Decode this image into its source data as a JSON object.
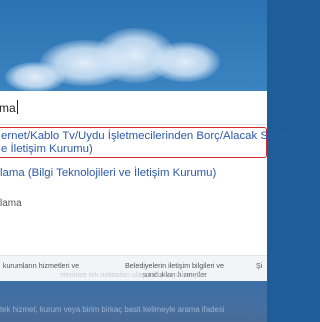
{
  "search": {
    "value": "ma"
  },
  "suggestions": [
    {
      "line1": "ernet/Kablo Tv/Uydu İşletmecilerinden Borç/Alacak Sorgu",
      "line2": "e İletişim Kurumu)"
    },
    {
      "line1": "lama (Bilgi Teknolojileri ve İletişim Kurumu)"
    },
    {
      "line1": "lama"
    }
  ],
  "cards": [
    {
      "line1": "kurumların hizmetleri ve",
      "line2": ""
    },
    {
      "line1": "Belediyelerin iletişim bilgileri ve",
      "line2": "sundukları hizmetler"
    },
    {
      "line1": "Şi",
      "line2": ""
    }
  ],
  "ghost_text": "elerinize tek noktadan ulaşabilir, başvuru işle",
  "bottom_hint": "tek hizmet, kurum veya birim birkaç basit kelimeyle arama ifadesi"
}
